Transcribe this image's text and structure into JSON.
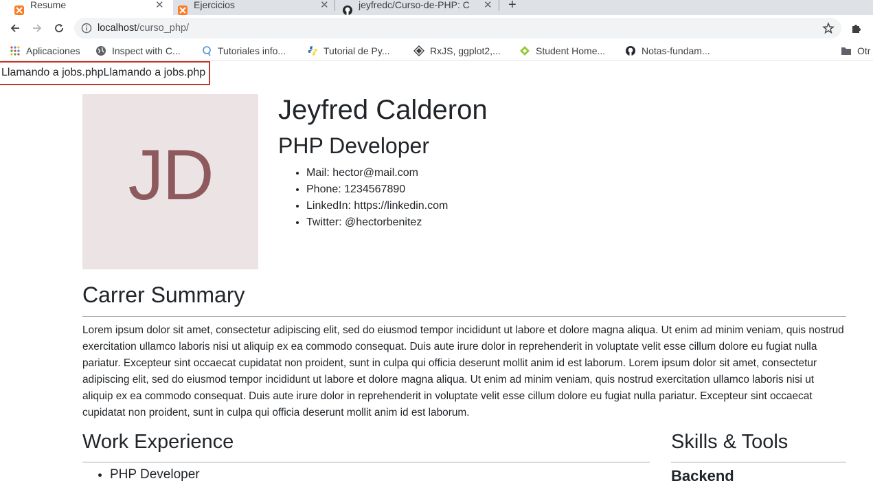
{
  "browser": {
    "tabs": [
      {
        "title": "Resume",
        "active": true,
        "favicon": "xampp-icon"
      },
      {
        "title": "Ejercicios",
        "active": false,
        "favicon": "xampp-icon"
      },
      {
        "title": "jeyfredc/Curso-de-PHP: C",
        "active": false,
        "favicon": "github-icon"
      }
    ],
    "url_host": "localhost",
    "url_path": "/curso_php/",
    "bookmarks": [
      {
        "label": "Aplicaciones",
        "icon": "apps-grid-icon"
      },
      {
        "label": "Inspect with C...",
        "icon": "globe-icon"
      },
      {
        "label": "Tutoriales info...",
        "icon": "tutoriales-icon"
      },
      {
        "label": "Tutorial de Py...",
        "icon": "python-icon"
      },
      {
        "label": "RxJS, ggplot2,...",
        "icon": "diamond-icon"
      },
      {
        "label": "Student Home...",
        "icon": "student-icon"
      },
      {
        "label": "Notas-fundam...",
        "icon": "github-icon"
      },
      {
        "label": "Otr",
        "icon": "folder-icon"
      }
    ]
  },
  "debug_text": "Llamando a jobs.phpLlamando a jobs.php",
  "profile": {
    "initials": "JD",
    "name": "Jeyfred Calderon",
    "role": "PHP Developer",
    "contacts": [
      "Mail: hector@mail.com",
      "Phone: 1234567890",
      "LinkedIn: https://linkedin.com",
      "Twitter: @hectorbenitez"
    ]
  },
  "summary": {
    "heading": "Carrer Summary",
    "text": "Lorem ipsum dolor sit amet, consectetur adipiscing elit, sed do eiusmod tempor incididunt ut labore et dolore magna aliqua. Ut enim ad minim veniam, quis nostrud exercitation ullamco laboris nisi ut aliquip ex ea commodo consequat. Duis aute irure dolor in reprehenderit in voluptate velit esse cillum dolore eu fugiat nulla pariatur. Excepteur sint occaecat cupidatat non proident, sunt in culpa qui officia deserunt mollit anim id est laborum. Lorem ipsum dolor sit amet, consectetur adipiscing elit, sed do eiusmod tempor incididunt ut labore et dolore magna aliqua. Ut enim ad minim veniam, quis nostrud exercitation ullamco laboris nisi ut aliquip ex ea commodo consequat. Duis aute irure dolor in reprehenderit in voluptate velit esse cillum dolore eu fugiat nulla pariatur. Excepteur sint occaecat cupidatat non proident, sunt in culpa qui officia deserunt mollit anim id est laborum."
  },
  "work": {
    "heading": "Work Experience",
    "jobs": [
      "PHP Developer"
    ]
  },
  "skills": {
    "heading": "Skills & Tools",
    "subheading": "Backend"
  },
  "colors": {
    "logo_bg": "#ece4e4",
    "logo_text": "#8e5a5e",
    "debug_border": "#c0392b"
  }
}
